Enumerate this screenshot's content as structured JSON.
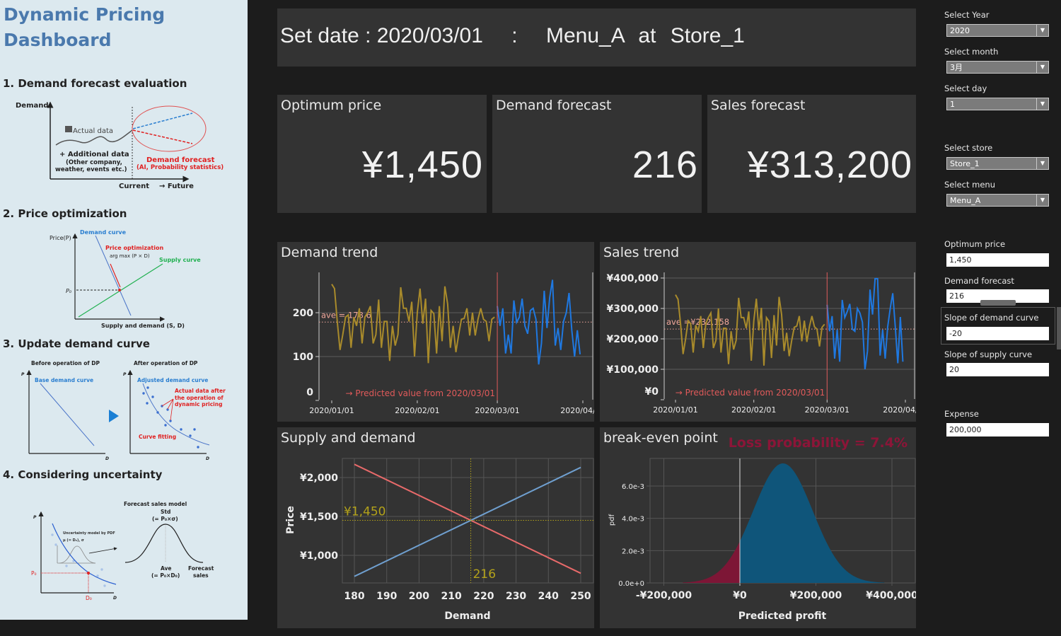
{
  "left_panel": {
    "title_line1": "Dynamic Pricing",
    "title_line2": "Dashboard",
    "section1": {
      "heading": "1. Demand forecast evaluation",
      "y_label": "Demand",
      "actual_data": "Actual data",
      "additional_1": "+ Additional data",
      "additional_2": "(Other company,",
      "additional_3": "weather, events etc.)",
      "forecast_1": "Demand forecast",
      "forecast_2": "(AI, Probability statistics)",
      "x_current": "Current",
      "x_future": "→ Future"
    },
    "section2": {
      "heading": "2. Price optimization",
      "y_label": "Price(P)",
      "demand_curve": "Demand curve",
      "price_opt": "Price optimization",
      "argmax": "arg max (P × D)",
      "supply_curve": "Supply curve",
      "p0": "P₀",
      "x_label": "Supply and demand (S, D)"
    },
    "section3": {
      "heading": "3. Update demand curve",
      "before": "Before operation of DP",
      "after": "After operation of DP",
      "p": "P",
      "d": "D",
      "base_curve": "Base demand curve",
      "adjusted_curve": "Adjusted demand curve",
      "actual_1": "Actual data after",
      "actual_2": "the operation of",
      "actual_3": "dynamic pricing",
      "curve_fitting": "Curve fitting"
    },
    "section4": {
      "heading": "4. Considering uncertainty",
      "p": "P",
      "d": "D",
      "pdf_1": "Uncertainty model by PDF",
      "pdf_2": "μ (= D₀), σ",
      "p0": "P₀",
      "d0": "D₀",
      "model_title": "Forecast sales model",
      "std": "Std",
      "std_formula": "(= P₀×σ)",
      "ave": "Ave",
      "ave_formula": "(= P₀×D₀)",
      "forecast_1": "Forecast",
      "forecast_2": "sales"
    }
  },
  "header": {
    "set_date_label": "Set date :",
    "date": "2020/03/01",
    "sep": ":",
    "menu": "Menu_A",
    "at": "at",
    "store": "Store_1"
  },
  "kpis": [
    {
      "label": "Optimum price",
      "value": "¥1,450"
    },
    {
      "label": "Demand forecast",
      "value": "216"
    },
    {
      "label": "Sales forecast",
      "value": "¥313,200"
    }
  ],
  "sidebar": {
    "year": {
      "label": "Select Year",
      "value": "2020"
    },
    "month": {
      "label": "Select month",
      "value": "3月"
    },
    "day": {
      "label": "Select day",
      "value": "1"
    },
    "store": {
      "label": "Select store",
      "value": "Store_1"
    },
    "menu": {
      "label": "Select menu",
      "value": "Menu_A"
    },
    "optimum_price": {
      "label": "Optimum price",
      "value": "1,450"
    },
    "demand_forecast": {
      "label": "Demand forecast",
      "value": "216"
    },
    "slope_demand": {
      "label": "Slope of demand curve",
      "value": "-20"
    },
    "slope_supply": {
      "label": "Slope of supply curve",
      "value": "20"
    },
    "expense": {
      "label": "Expense",
      "value": "200,000"
    }
  },
  "colors": {
    "actual": "#a98b2b",
    "forecast": "#1f78e0",
    "divider": "#e05a5a",
    "average": "#f2a89c",
    "demand_line": "#e86a6a",
    "supply_line": "#6f9fcf",
    "optimum": "#b3a21a",
    "loss": "#7d1636",
    "profit": "#0f557a",
    "loss_text": "#8c1538"
  },
  "chart_data": [
    {
      "type": "line",
      "title": "Demand trend",
      "start": "2020/01/01",
      "forecast_start": "2020/03/01",
      "x_ticks": [
        "2020/01/01",
        "2020/02/01",
        "2020/03/01",
        "2020/04/01"
      ],
      "y_ticks": [
        "0",
        "100",
        "200"
      ],
      "y_tick_values": [
        0,
        100,
        200
      ],
      "average_label": "ave = 178.6",
      "average": 178.6,
      "annotation": "→ Predicted value from 2020/03/01",
      "actual": [
        265,
        255,
        180,
        115,
        150,
        190,
        195,
        120,
        190,
        170,
        210,
        130,
        190,
        200,
        215,
        130,
        150,
        230,
        120,
        180,
        180,
        90,
        170,
        125,
        150,
        258,
        210,
        210,
        180,
        225,
        100,
        200,
        255,
        175,
        232,
        85,
        205,
        198,
        107,
        215,
        135,
        260,
        220,
        120,
        170,
        110,
        150,
        185,
        187,
        210,
        148,
        200,
        148,
        185,
        210,
        185,
        180,
        135,
        185,
        190
      ],
      "forecast": [
        215,
        170,
        210,
        107,
        150,
        107,
        228,
        178,
        190,
        232,
        170,
        152,
        205,
        210,
        185,
        82,
        130,
        250,
        165,
        235,
        275,
        125,
        165,
        115,
        180,
        200,
        245,
        160,
        100,
        160,
        105
      ]
    },
    {
      "type": "line",
      "title": "Sales trend",
      "start": "2020/01/01",
      "forecast_start": "2020/03/01",
      "x_ticks": [
        "2020/01/01",
        "2020/02/01",
        "2020/03/01",
        "2020/04/01"
      ],
      "y_ticks": [
        "¥0",
        "¥100,000",
        "¥200,000",
        "¥300,000",
        "¥400,000"
      ],
      "y_tick_values": [
        0,
        100000,
        200000,
        300000,
        400000
      ],
      "average_label": "ave =¥232,158",
      "average": 232158,
      "annotation": "→ Predicted value from 2020/03/01",
      "actual": [
        345000,
        330000,
        250000,
        150000,
        200000,
        260000,
        250000,
        155000,
        245000,
        225000,
        275000,
        170000,
        250000,
        270000,
        285000,
        170000,
        195000,
        300000,
        155000,
        235000,
        235000,
        117000,
        225000,
        165000,
        195000,
        335000,
        270000,
        270000,
        235000,
        290000,
        128000,
        260000,
        332000,
        228000,
        302000,
        112000,
        270000,
        258000,
        137000,
        278000,
        178000,
        338000,
        280000,
        160000,
        220000,
        143000,
        195000,
        238000,
        242000,
        275000,
        192000,
        260000,
        190000,
        240000,
        275000,
        240000,
        232000,
        175000,
        238000,
        248000
      ],
      "forecast": [
        312000,
        225000,
        275000,
        135000,
        230000,
        125000,
        328000,
        270000,
        290000,
        315000,
        232000,
        225000,
        300000,
        285000,
        255000,
        100000,
        160000,
        362000,
        280000,
        398000,
        398000,
        145000,
        230000,
        135000,
        240000,
        300000,
        350000,
        240000,
        120000,
        272000,
        125000
      ]
    },
    {
      "type": "line",
      "title": "Supply and demand",
      "xlabel": "Demand",
      "ylabel": "Price",
      "x_ticks": [
        "180",
        "190",
        "200",
        "210",
        "220",
        "230",
        "240",
        "250"
      ],
      "x_tick_values": [
        180,
        190,
        200,
        210,
        220,
        230,
        240,
        250
      ],
      "y_ticks": [
        "¥1,000",
        "¥1,500",
        "¥2,000"
      ],
      "y_tick_values": [
        1000,
        1500,
        2000
      ],
      "series": [
        {
          "x": [
            180,
            250
          ],
          "y": [
            2170,
            770
          ]
        },
        {
          "x": [
            180,
            250
          ],
          "y": [
            730,
            2130
          ]
        }
      ],
      "optimum_price_label": "¥1,450",
      "optimum_price": 1450,
      "optimum_demand_label": "216",
      "optimum_demand": 216
    },
    {
      "type": "area",
      "title": "break-even point",
      "annotation": "Loss probability = 7.4%",
      "xlabel": "Predicted profit",
      "ylabel": "pdf",
      "x_ticks": [
        "-¥200,000",
        "¥0",
        "¥200,000",
        "¥400,000"
      ],
      "x_tick_values": [
        -200000,
        0,
        200000,
        400000
      ],
      "y_ticks": [
        "0.0e+0",
        "2.0e-3",
        "4.0e-3",
        "6.0e-3"
      ],
      "y_tick_values": [
        0,
        0.002,
        0.004,
        0.006
      ],
      "mean": 113200,
      "std": 78000,
      "peak_pdf": 0.0074,
      "range": [
        -150000,
        380000
      ]
    }
  ]
}
